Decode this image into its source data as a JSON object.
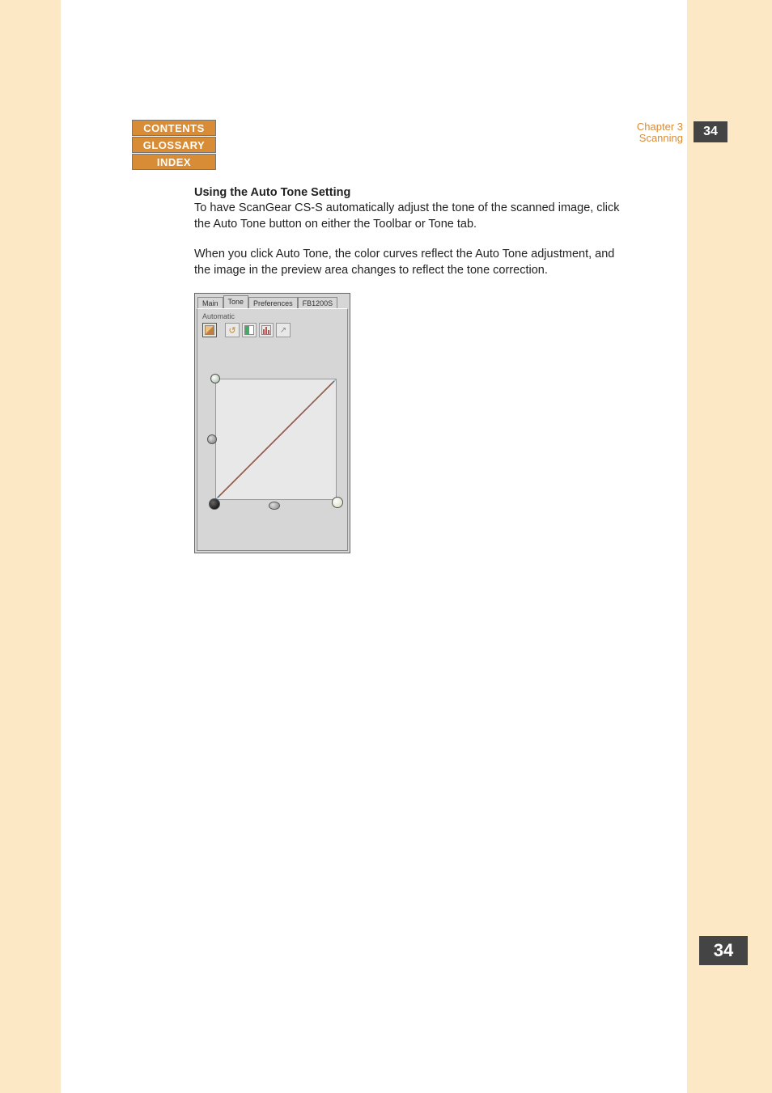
{
  "nav": {
    "contents": "CONTENTS",
    "glossary": "GLOSSARY",
    "index": "INDEX"
  },
  "header": {
    "chapter": "Chapter 3",
    "section": "Scanning",
    "page": "34"
  },
  "footer": {
    "page": "34"
  },
  "body": {
    "heading": "Using the Auto Tone Setting",
    "para1": "To have ScanGear CS-S automatically adjust the tone of the scanned image, click the Auto Tone button on either the Toolbar or Tone tab.",
    "para2": "When you click Auto Tone, the color curves reflect the Auto Tone adjustment, and the image in the preview area changes to reflect the tone correction."
  },
  "panel": {
    "tabs": {
      "main": "Main",
      "tone": "Tone",
      "preferences": "Preferences",
      "device": "FB1200S"
    },
    "mode_label": "Automatic",
    "toolbar": {
      "auto": "auto-tone-icon",
      "reset": "reset-icon",
      "contrast": "contrast-icon",
      "histogram": "histogram-icon",
      "curve": "curve-icon"
    }
  }
}
